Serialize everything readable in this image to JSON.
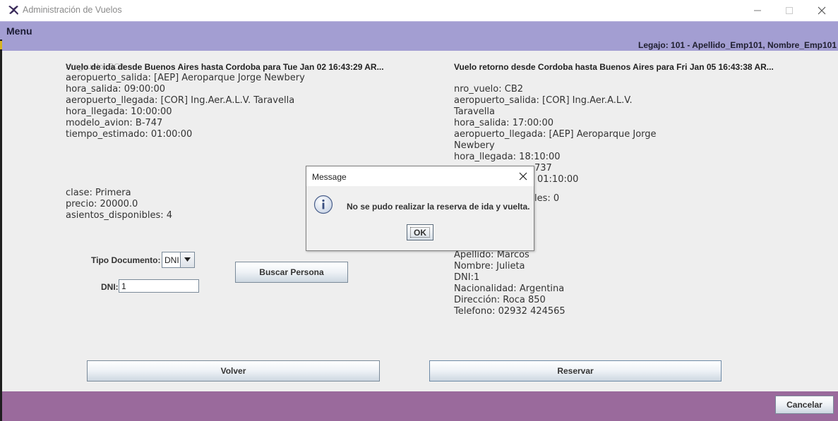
{
  "window": {
    "title": "Administración de Vuelos",
    "icon": "airplane-icon",
    "controls": [
      "minimize-icon",
      "maximize-icon",
      "close-icon"
    ]
  },
  "menu": {
    "label": "Menu"
  },
  "legajo": "Legajo: 101 - Apellido_Emp101, Nombre_Emp101",
  "outbound": {
    "header": "Vuelo de ida desde Buenos Aires hasta Cordoba para Tue Jan 02 16:43:29 AR...",
    "header_overlap": "nro_vuelo: BC2",
    "lines": [
      "aeropuerto_salida: [AEP] Aeroparque Jorge Newbery",
      "hora_salida: 09:00:00",
      "aeropuerto_llegada: [COR] Ing.Aer.A.L.V. Taravella",
      "hora_llegada: 10:00:00",
      "modelo_avion: B-747",
      "tiempo_estimado: 01:00:00"
    ],
    "class_lines": [
      "clase: Primera",
      "precio: 20000.0",
      "asientos_disponibles: 4"
    ]
  },
  "return": {
    "header": "Vuelo retorno desde Cordoba hasta Buenos Aires para Fri Jan 05 16:43:38 AR...",
    "lines": [
      "nro_vuelo: CB2",
      "aeropuerto_salida: [COR] Ing.Aer.A.L.V.",
      "Taravella",
      "hora_salida: 17:00:00",
      "aeropuerto_llegada: [AEP] Aeroparque Jorge",
      "Newbery",
      "hora_llegada: 18:10:00"
    ],
    "partial_modelo": "737",
    "partial_tiempo": "01:10:00",
    "partial_asientos": "les: 0"
  },
  "persona": {
    "lines": [
      "Apellido: Marcos",
      "Nombre: Julieta",
      "DNI:1",
      "Nacionalidad: Argentina",
      "Dirección: Roca 850",
      "Telefono: 02932 424565"
    ]
  },
  "form": {
    "tipo_documento_label": "Tipo Documento:",
    "tipo_documento_value": "DNI",
    "dni_label": "DNI:",
    "dni_value": "1",
    "buscar_label": "Buscar Persona"
  },
  "buttons": {
    "volver": "Volver",
    "reservar": "Reservar",
    "cancelar": "Cancelar"
  },
  "dialog": {
    "title": "Message",
    "message": "No se pudo realizar la reserva de ida y vuelta.",
    "ok": "OK",
    "icon": "info-icon"
  },
  "colors": {
    "menubar": "#a39ed2",
    "bottombar": "#9a6a9c",
    "panel": "#eeeeee"
  }
}
